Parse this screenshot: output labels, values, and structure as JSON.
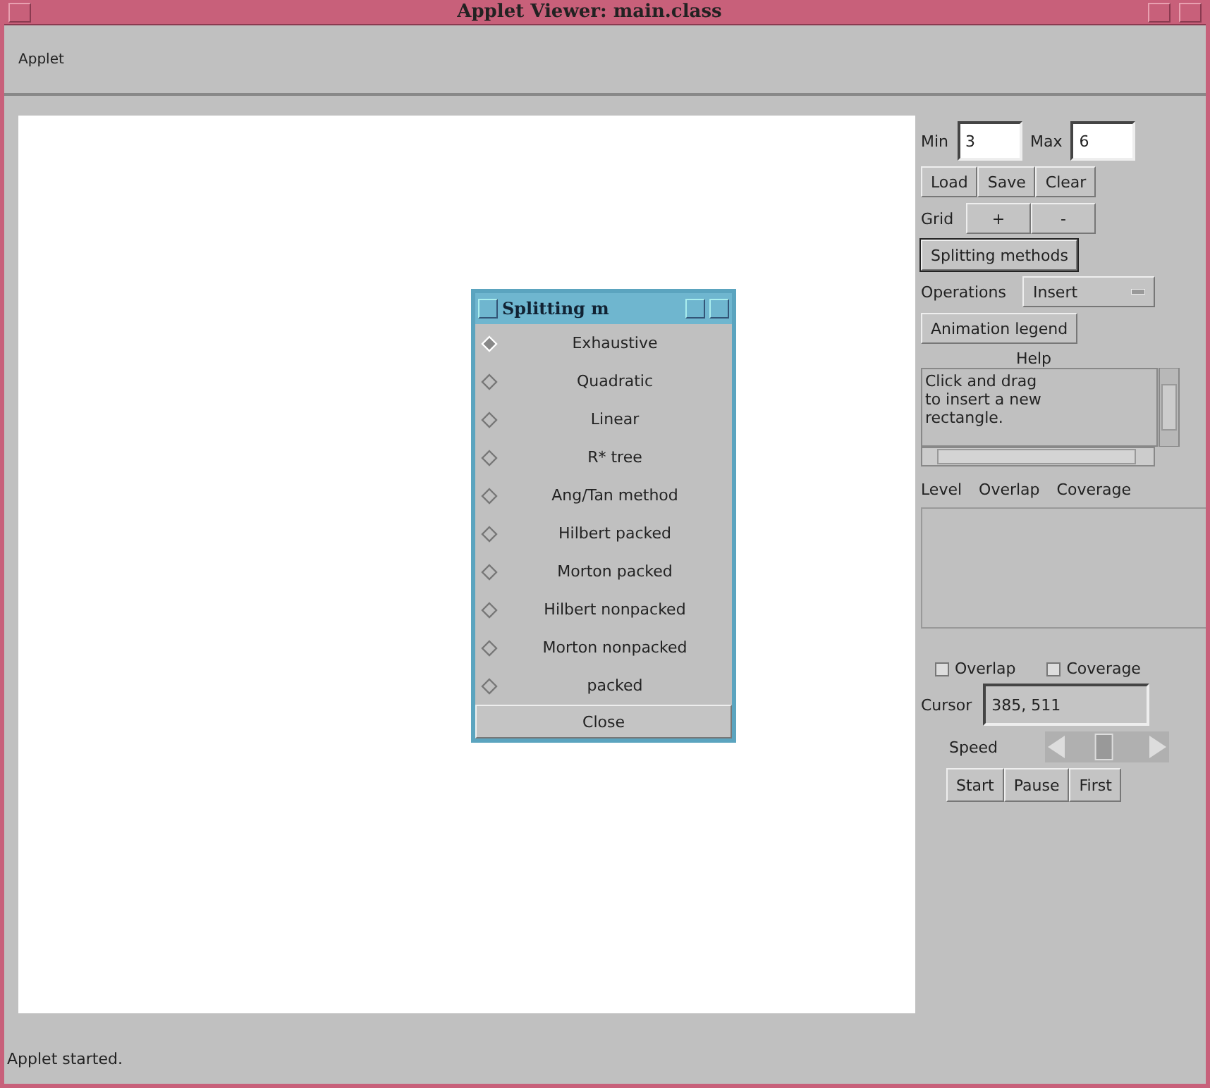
{
  "window": {
    "title": "Applet Viewer: main.class"
  },
  "menu": [
    "Applet"
  ],
  "dialog": {
    "title": "Splitting m",
    "options": [
      {
        "label": "Exhaustive",
        "selected": true
      },
      {
        "label": "Quadratic",
        "selected": false
      },
      {
        "label": "Linear",
        "selected": false
      },
      {
        "label": "R* tree",
        "selected": false
      },
      {
        "label": "Ang/Tan method",
        "selected": false
      },
      {
        "label": "Hilbert packed",
        "selected": false
      },
      {
        "label": "Morton packed",
        "selected": false
      },
      {
        "label": "Hilbert nonpacked",
        "selected": false
      },
      {
        "label": "Morton nonpacked",
        "selected": false
      },
      {
        "label": "packed",
        "selected": false
      }
    ],
    "close": "Close"
  },
  "panel": {
    "min": {
      "label": "Min",
      "value": "3"
    },
    "max": {
      "label": "Max",
      "value": "6"
    },
    "file_buttons": [
      "Load",
      "Save",
      "Clear"
    ],
    "grid": {
      "label": "Grid",
      "buttons": [
        "+",
        "-"
      ]
    },
    "splitting_button": "Splitting methods",
    "operations": {
      "label": "Operations",
      "value": "Insert"
    },
    "legend_button": "Animation legend",
    "help": {
      "label": "Help",
      "text": "Click and drag\nto insert a new\nrectangle."
    },
    "stats_columns": [
      "Level",
      "Overlap",
      "Coverage"
    ],
    "checkboxes": [
      {
        "label": "Overlap",
        "checked": false
      },
      {
        "label": "Coverage",
        "checked": false
      }
    ],
    "cursor": {
      "label": "Cursor",
      "value": "385, 511"
    },
    "speed": {
      "label": "Speed",
      "level": 0.45
    },
    "run_buttons": [
      "Start",
      "Pause",
      "First"
    ]
  },
  "status_bar": "Applet started."
}
